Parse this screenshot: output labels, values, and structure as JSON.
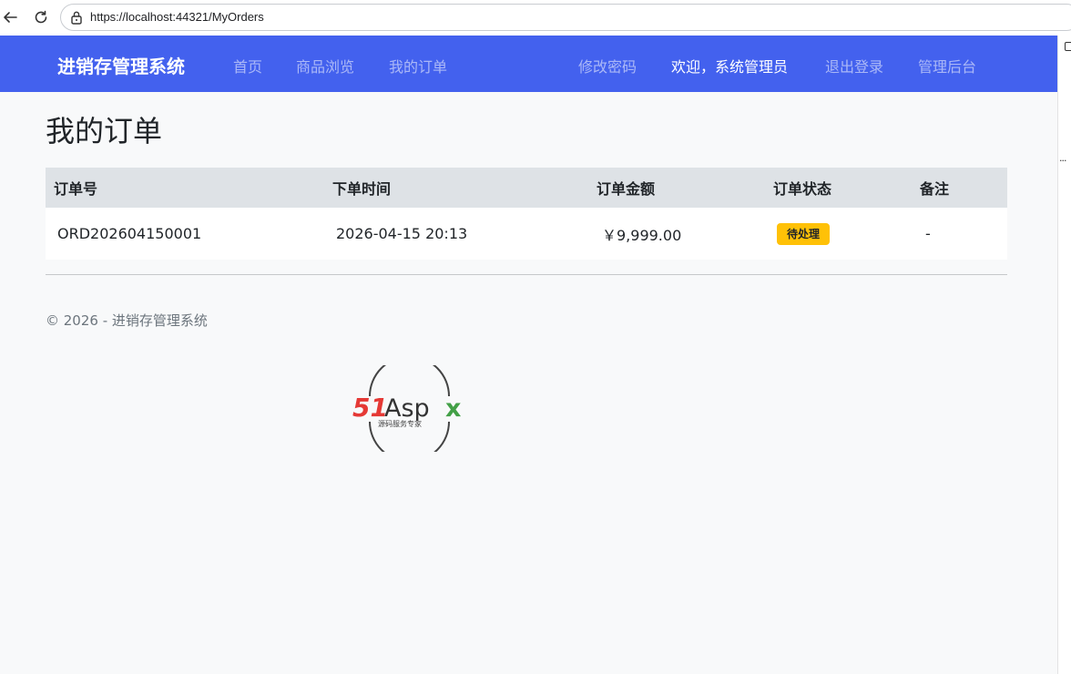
{
  "browser": {
    "url": "https://localhost:44321/MyOrders"
  },
  "navbar": {
    "brand": "进销存管理系统",
    "links": [
      {
        "label": "首页"
      },
      {
        "label": "商品浏览"
      },
      {
        "label": "我的订单"
      }
    ],
    "right_links": [
      {
        "label": "修改密码"
      },
      {
        "label": "欢迎，系统管理员"
      },
      {
        "label": "退出登录"
      },
      {
        "label": "管理后台"
      }
    ],
    "bg_color": "#4361ee"
  },
  "main": {
    "title": "我的订单",
    "table": {
      "headers": [
        "订单号",
        "下单时间",
        "订单金额",
        "订单状态",
        "备注"
      ],
      "rows": [
        {
          "order_no": "ORD202604150001",
          "time": "2026-04-15 20:13",
          "amount": "￥9,999.00",
          "status": "待处理",
          "note": "-"
        }
      ]
    },
    "status_color": "#ffc107"
  },
  "footer": {
    "text": "© 2026 - 进销存管理系统"
  },
  "watermark": {
    "logo_red": "51",
    "logo_dark": "Asp",
    "logo_green": "x",
    "logo_sub": "源码服务专家"
  }
}
